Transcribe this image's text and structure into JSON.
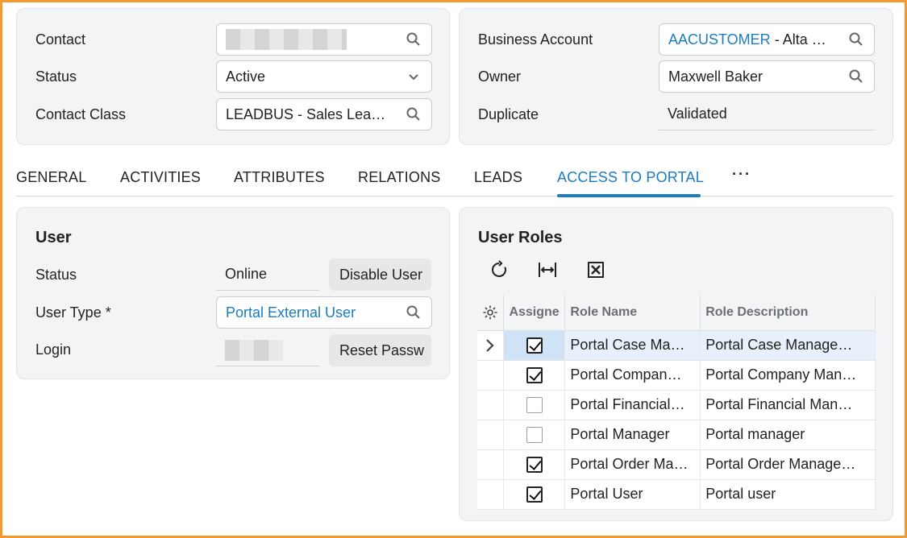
{
  "header_left": {
    "contact_label": "Contact",
    "status_label": "Status",
    "status_value": "Active",
    "contact_class_label": "Contact Class",
    "contact_class_value": "LEADBUS - Sales Lea…"
  },
  "header_right": {
    "business_account_label": "Business Account",
    "business_account_code": "AACUSTOMER",
    "business_account_rest": " - Alta …",
    "owner_label": "Owner",
    "owner_value": "Maxwell Baker",
    "duplicate_label": "Duplicate",
    "duplicate_value": "Validated"
  },
  "tabs": [
    {
      "label": "GENERAL"
    },
    {
      "label": "ACTIVITIES"
    },
    {
      "label": "ATTRIBUTES"
    },
    {
      "label": "RELATIONS"
    },
    {
      "label": "LEADS"
    },
    {
      "label": "ACCESS TO PORTAL"
    },
    {
      "label": "···"
    }
  ],
  "active_tab": "ACCESS TO PORTAL",
  "user_panel": {
    "title": "User",
    "status_label": "Status",
    "status_value": "Online",
    "disable_button": "Disable User",
    "user_type_label": "User Type *",
    "user_type_value": "Portal External User",
    "login_label": "Login",
    "reset_button": "Reset Passw"
  },
  "roles_panel": {
    "title": "User Roles",
    "columns": [
      "Assigne",
      "Role Name",
      "Role Description"
    ],
    "rows": [
      {
        "assigned": true,
        "name": "Portal Case Ma…",
        "description": "Portal Case Manage…",
        "selected": true
      },
      {
        "assigned": true,
        "name": "Portal Compan…",
        "description": "Portal Company Man…",
        "selected": false
      },
      {
        "assigned": false,
        "name": "Portal Financial…",
        "description": "Portal Financial Man…",
        "selected": false
      },
      {
        "assigned": false,
        "name": "Portal Manager",
        "description": "Portal manager",
        "selected": false
      },
      {
        "assigned": true,
        "name": "Portal Order Ma…",
        "description": "Portal Order Manage…",
        "selected": false
      },
      {
        "assigned": true,
        "name": "Portal User",
        "description": "Portal user",
        "selected": false
      }
    ]
  },
  "colors": {
    "accent": "#1a7cc1",
    "frame": "#f29a2e",
    "panel_bg": "#f3f4f6"
  }
}
